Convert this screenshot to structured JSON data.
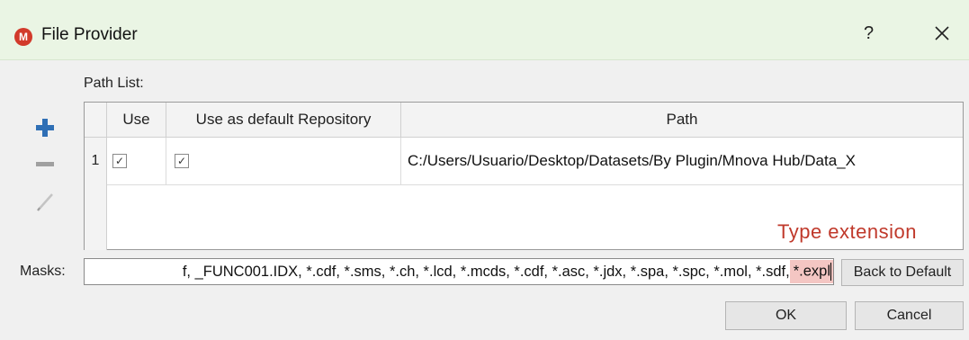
{
  "window": {
    "title": "File Provider",
    "app_icon_letter": "M",
    "help_label": "?"
  },
  "path_list": {
    "label": "Path List:",
    "columns": [
      "Use",
      "Use as default Repository",
      "Path"
    ],
    "rows": [
      {
        "number": "1",
        "use": true,
        "default_repo": true,
        "path": "C:/Users/Usuario/Desktop/Datasets/By Plugin/Mnova Hub/Data_X"
      }
    ]
  },
  "annotation": "Type extension",
  "masks": {
    "label": "Masks:",
    "value_visible": "f, _FUNC001.IDX, *.cdf, *.sms, *.ch, *.lcd, *.mcds, *.cdf, *.asc, *.jdx, *.spa, *.spc, *.mol, *.sdf, ",
    "highlighted": "*.expl"
  },
  "buttons": {
    "back_to_default": "Back to Default",
    "ok": "OK",
    "cancel": "Cancel"
  },
  "colors": {
    "titlebar": "#eaf5e4",
    "add_icon": "#2f6fb5",
    "annotation": "#c0392b",
    "highlight": "#f4c6c3"
  }
}
